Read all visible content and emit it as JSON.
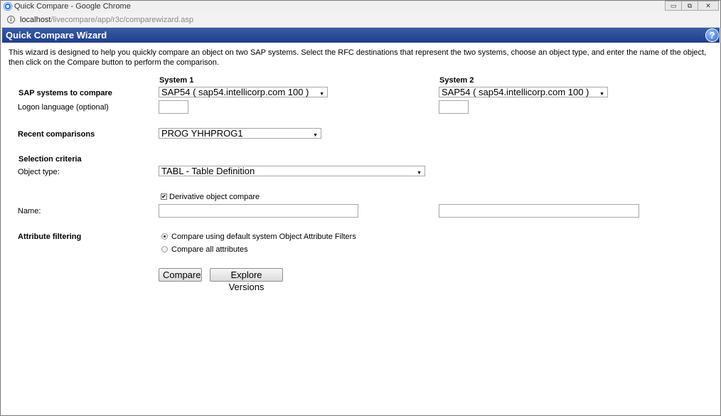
{
  "window": {
    "title": "Quick Compare - Google Chrome",
    "minimize_glyph": "▭",
    "restore_glyph": "⧉",
    "close_glyph": "✕"
  },
  "address": {
    "host": "localhost",
    "path": "/livecompare/app/r3c/comparewizard.asp"
  },
  "header": {
    "title": "Quick Compare Wizard",
    "help_glyph": "?"
  },
  "intro": "This wizard is designed to help you quickly compare an object on two SAP systems. Select the RFC destinations that represent the two systems, choose an object type, and enter the name of the object, then click on the Compare button to perform the comparison.",
  "columns": {
    "system1": "System 1",
    "system2": "System 2"
  },
  "labels": {
    "sap_systems": "SAP systems to compare",
    "logon_language": "Logon language (optional)",
    "recent_comparisons": "Recent comparisons",
    "selection_criteria": "Selection criteria",
    "object_type": "Object type:",
    "name": "Name:",
    "attribute_filtering": "Attribute filtering"
  },
  "fields": {
    "system1_select": "SAP54 ( sap54.intellicorp.com  100 )",
    "system2_select": "SAP54 ( sap54.intellicorp.com  100 )",
    "logon_language_1": "",
    "logon_language_2": "",
    "recent_select": "PROG YHHPROG1",
    "object_type_select": "TABL - Table Definition",
    "derivative_label": "Derivative object compare",
    "derivative_checked": true,
    "name_1": "",
    "name_2": ""
  },
  "attribute_options": {
    "default_filters": "Compare using default system Object Attribute Filters",
    "all_attributes": "Compare all attributes",
    "selected": "default_filters"
  },
  "buttons": {
    "compare": "Compare",
    "explore": "Explore Versions"
  },
  "glyphs": {
    "dropdown_arrow": "▼",
    "checkmark": "✔",
    "info": "i"
  }
}
